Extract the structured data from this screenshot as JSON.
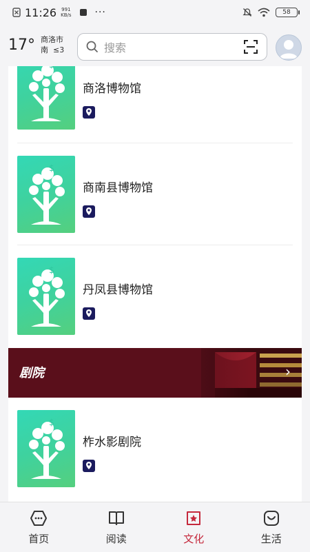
{
  "status": {
    "time": "11:26",
    "net_speed": "991",
    "net_unit": "KB/s",
    "battery": "58"
  },
  "header": {
    "temperature": "17°",
    "city": "商洛市",
    "wind_dir": "南",
    "wind_level": "≤3",
    "search_placeholder": "搜索"
  },
  "items": [
    {
      "title": "商洛博物馆"
    },
    {
      "title": "商南县博物馆"
    },
    {
      "title": "丹凤县博物馆"
    },
    {
      "title": "柞水影剧院"
    }
  ],
  "banner": {
    "label": "剧院"
  },
  "tabs": [
    {
      "label": "首页",
      "icon": "home-icon"
    },
    {
      "label": "阅读",
      "icon": "book-icon"
    },
    {
      "label": "文化",
      "icon": "culture-icon",
      "active": true
    },
    {
      "label": "生活",
      "icon": "life-icon"
    }
  ],
  "colors": {
    "accent": "#c5283c",
    "banner_bg": "#5a0f1b",
    "thumb_green": "#3fd29e"
  }
}
